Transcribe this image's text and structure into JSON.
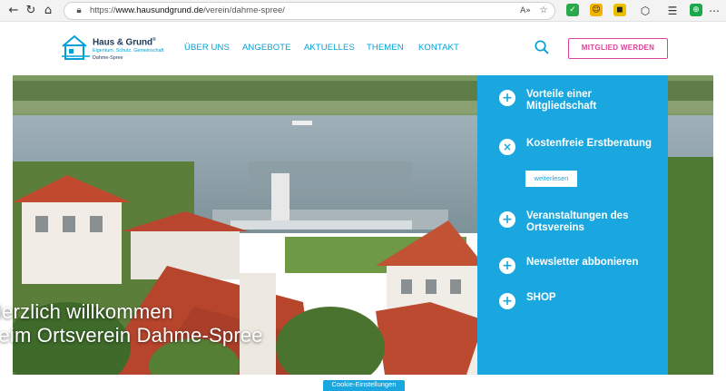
{
  "browser": {
    "url_scheme": "https://",
    "url_host": "www.hausundgrund.de",
    "url_path": "/verein/dahme-spree/",
    "back_icon": "back-arrow-icon",
    "refresh_icon": "refresh-icon",
    "home_icon": "home-icon"
  },
  "logo": {
    "title": "Haus & Grund",
    "registered": "®",
    "tagline": "Eigentum. Schutz. Gemeinschaft",
    "subtitle": "Dahme-Spree"
  },
  "nav": {
    "items": [
      "ÜBER UNS",
      "ANGEBOTE",
      "AKTUELLES",
      "THEMEN",
      "KONTAKT"
    ],
    "member_button": "MITGLIED WERDEN"
  },
  "hero": {
    "welcome_line1": "Herzlich willkommen",
    "welcome_line2": "beim Ortsverein Dahme-Spree"
  },
  "panel": {
    "items": [
      {
        "label": "Vorteile einer Mitgliedschaft",
        "icon": "plus"
      },
      {
        "label": "Kostenfreie Erstberatung",
        "icon": "close"
      },
      {
        "label": "Veranstaltungen des Ortsvereins",
        "icon": "plus"
      },
      {
        "label": "Newsletter abbonieren",
        "icon": "plus"
      },
      {
        "label": "SHOP",
        "icon": "plus"
      }
    ],
    "more_button": "weiterlesen"
  },
  "cookie_tab": "Cookie-Einstellungen",
  "colors": {
    "accent_blue": "#1aa7df",
    "brand_navy": "#1b3a5c",
    "member_pink": "#d9449a"
  }
}
